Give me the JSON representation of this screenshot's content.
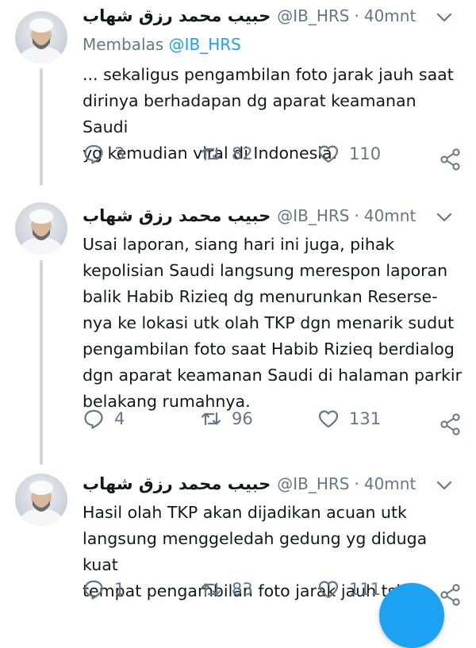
{
  "tweets": [
    {
      "display_name": "حبيب محمد رزق شهاب",
      "handle": "@IB_HRS",
      "separator": "·",
      "time": "40mnt",
      "reply_prefix": "Membalas",
      "reply_to": "@IB_HRS",
      "text": "... sekaligus pengambilan foto jarak jauh saat\ndirinya berhadapan dg aparat keamanan Saudi\nyg kemudian viral di Indonesia.",
      "replies": "3",
      "retweets": "82",
      "likes": "110"
    },
    {
      "display_name": "حبيب محمد رزق شهاب",
      "handle": "@IB_HRS",
      "separator": "·",
      "time": "40mnt",
      "text": "Usai laporan, siang hari ini juga, pihak\nkepolisian Saudi langsung merespon laporan\nbalik Habib Rizieq dg menurunkan Reserse-\nnya ke lokasi utk olah TKP dgn menarik sudut\npengambilan foto saat Habib Rizieq berdialog\ndgn aparat keamanan Saudi di halaman parkir\nbelakang rumahnya.",
      "replies": "4",
      "retweets": "96",
      "likes": "131"
    },
    {
      "display_name": "حبيب محمد رزق شهاب",
      "handle": "@IB_HRS",
      "separator": "·",
      "time": "40mnt",
      "text": "Hasil olah TKP akan dijadikan acuan utk\nlangsung menggeledah gedung yg diduga kuat\ntempat pengambilan foto jarak jauh tsb.",
      "replies": "1",
      "retweets": "83",
      "likes": "111"
    }
  ],
  "icons": {
    "reply": "reply-icon",
    "retweet": "retweet-icon",
    "like": "heart-icon",
    "share": "share-icon",
    "menu": "chevron-down-icon"
  },
  "colors": {
    "accent": "#1da1f2",
    "muted": "#657786",
    "text": "#14171a",
    "thread_line": "#cfd6dd"
  }
}
